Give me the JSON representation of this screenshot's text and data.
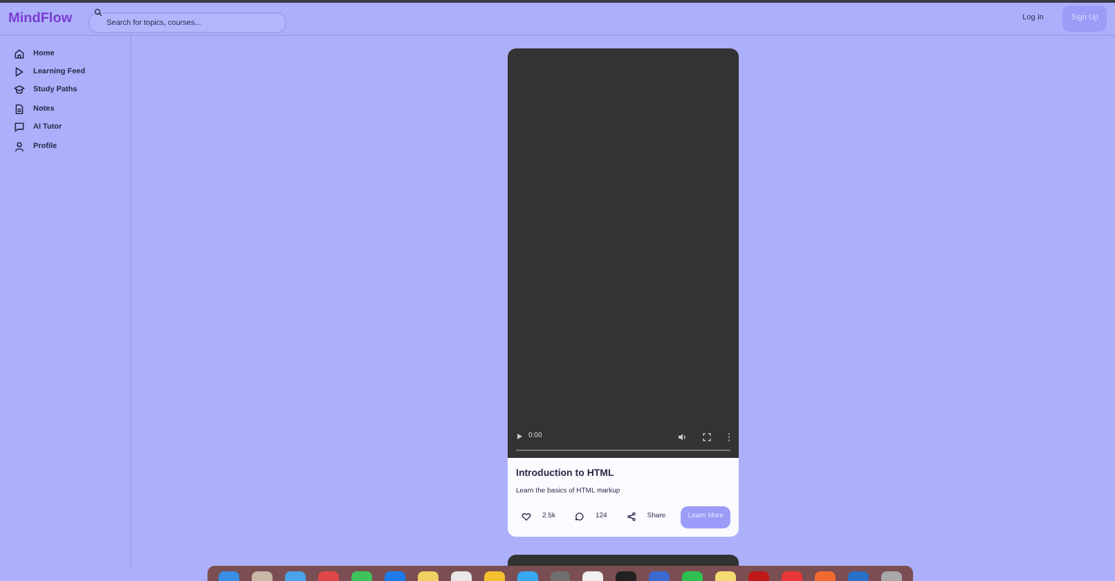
{
  "header": {
    "brand": "MindFlow",
    "search": {
      "placeholder": "Search for topics, courses..."
    },
    "login": "Log In",
    "signup": "Sign Up"
  },
  "sidebar": {
    "items": [
      {
        "label": "Home",
        "kind": "home"
      },
      {
        "label": "Learning Feed",
        "kind": "play"
      },
      {
        "label": "Study Paths",
        "kind": "cap"
      },
      {
        "label": "Notes",
        "kind": "note"
      },
      {
        "label": "AI Tutor",
        "kind": "chat"
      },
      {
        "label": "Profile",
        "kind": "user"
      }
    ]
  },
  "feed": [
    {
      "video": {
        "time": "0:00"
      },
      "title": "Introduction to HTML",
      "description": "Learn the basics of HTML markup",
      "likes": "2.5k",
      "comments": "124",
      "share": "Share",
      "action": "Learn More"
    }
  ],
  "dock": {
    "apps": [
      {
        "color": "#3a8ee6"
      },
      {
        "color": "#c9b8a8"
      },
      {
        "color": "#4aa3e8"
      },
      {
        "color": "#e04848"
      },
      {
        "color": "#3cc45a"
      },
      {
        "color": "#1e7ae8"
      },
      {
        "color": "#f0d060"
      },
      {
        "color": "#e8e8e8"
      },
      {
        "color": "#f5c030"
      },
      {
        "color": "#38a8f0"
      },
      {
        "color": "#707070"
      },
      {
        "color": "#f0f0f0"
      },
      {
        "color": "#222222"
      },
      {
        "color": "#3a6ad0"
      },
      {
        "color": "#30c050"
      },
      {
        "color": "#f5dc70"
      },
      {
        "color": "#c01818"
      },
      {
        "color": "#e83838"
      },
      {
        "color": "#f06a30"
      },
      {
        "color": "#2a70c8"
      },
      {
        "color": "#a8a8a8"
      }
    ]
  }
}
